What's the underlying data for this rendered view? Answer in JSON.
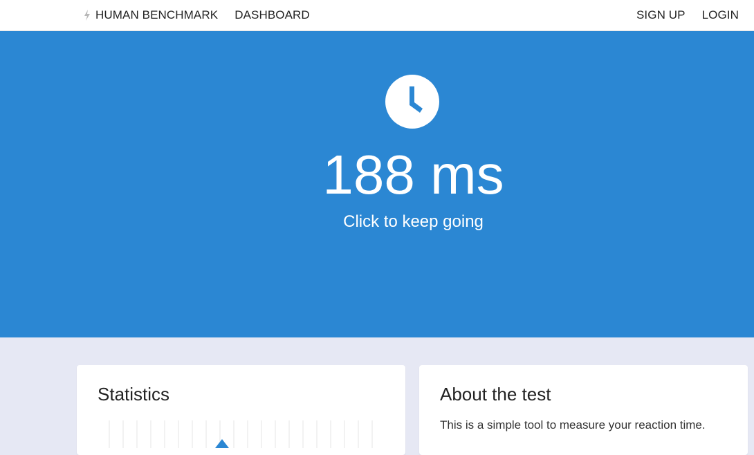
{
  "nav": {
    "brand_label": "HUMAN BENCHMARK",
    "brand_icon": "lightning-bolt-icon",
    "links": [
      "DASHBOARD"
    ],
    "sign_up": "SIGN UP",
    "login": "LOGIN"
  },
  "hero": {
    "icon": "clock-icon",
    "result": "188 ms",
    "hint": "Click to keep going",
    "background_color": "#2b87d3"
  },
  "statistics": {
    "title": "Statistics"
  },
  "about": {
    "title": "About the test",
    "text": "This is a simple tool to measure your reaction time."
  },
  "colors": {
    "accent": "#2b87d3",
    "page_background": "#e6e8f4"
  }
}
